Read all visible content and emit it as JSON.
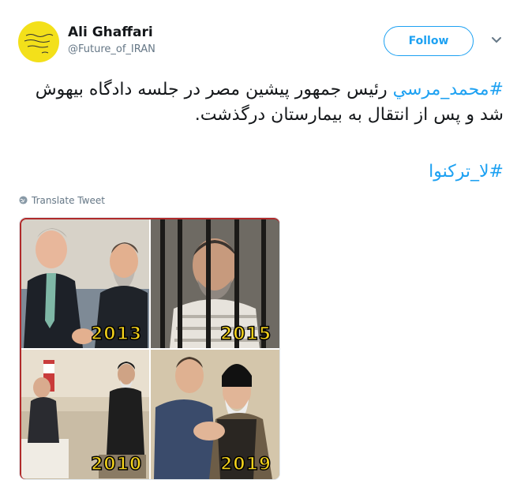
{
  "user": {
    "name": "Ali Ghaffari",
    "handle": "@Future_of_IRAN",
    "avatar_color": "#f3e01a"
  },
  "actions": {
    "follow_label": "Follow",
    "menu_icon": "chevron-down-icon"
  },
  "tweet": {
    "hashtag1": "#محمد_مرسي",
    "text": " رئیس جمهور پیشین مصر در جلسه دادگاه بیهوش شد و پس از انتقال به بیمارستان درگذشت.",
    "hashtag2": "#لا_ترکنوا",
    "translate_label": "Translate Tweet",
    "link_color": "#1da1f2"
  },
  "media": {
    "years": [
      "2013",
      "2015",
      "2010",
      "2019"
    ]
  }
}
